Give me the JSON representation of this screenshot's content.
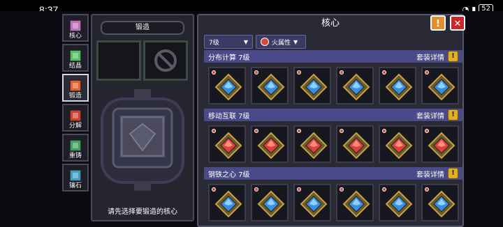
{
  "status": {
    "time": "8:37",
    "battery": "52"
  },
  "tabs": [
    {
      "label": "核心",
      "icon": "core-icon",
      "active": false
    },
    {
      "label": "结晶",
      "icon": "crystal-icon",
      "active": false
    },
    {
      "label": "锻造",
      "icon": "forge-icon",
      "active": true
    },
    {
      "label": "分解",
      "icon": "decompose-icon",
      "active": false
    },
    {
      "label": "重铸",
      "icon": "recast-icon",
      "active": false
    },
    {
      "label": "镶石",
      "icon": "inlay-icon",
      "active": false
    }
  ],
  "forge": {
    "title": "锻造",
    "hint": "请先选择要锻造的核心"
  },
  "cores": {
    "title": "核心",
    "level_filter": "7级",
    "attr_filter": "火属性",
    "sets": [
      {
        "name": "分布计算 7级",
        "detail": "套装详情",
        "gem": "blue"
      },
      {
        "name": "移动互联 7级",
        "detail": "套装详情",
        "gem": "red"
      },
      {
        "name": "钢铁之心 7级",
        "detail": "套装详情",
        "gem": "blue"
      }
    ],
    "cards_per_set": 6
  },
  "colors": {
    "panel": "#2a2a36",
    "header": "#4a4a88",
    "accent_gold": "#e0b020",
    "fire": "#d94a3a"
  }
}
